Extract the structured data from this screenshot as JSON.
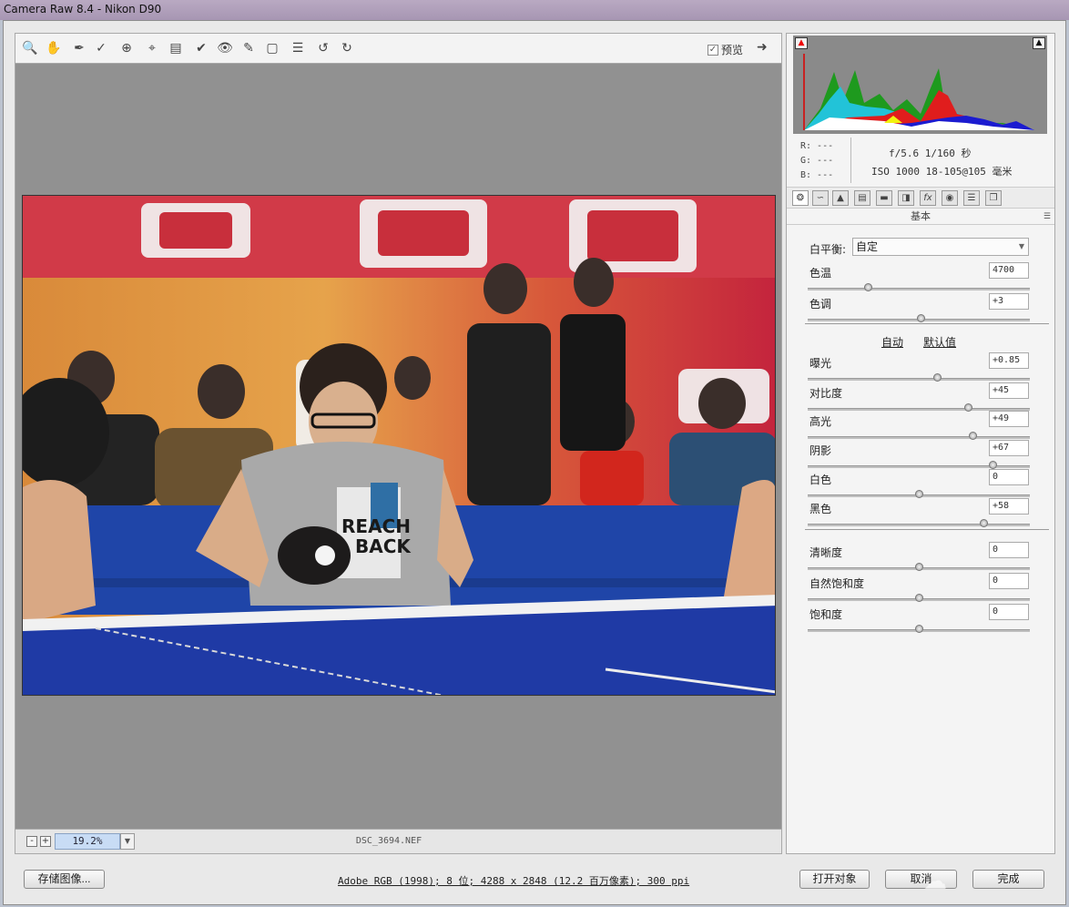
{
  "window": {
    "title": "Camera Raw 8.4 -  Nikon D90"
  },
  "toolbar": {
    "tools": [
      "zoom-icon",
      "hand-icon",
      "white-balance-icon",
      "color-sampler-icon",
      "targeted-adjustment-icon",
      "crop-icon",
      "straighten-icon",
      "spot-removal-icon",
      "red-eye-icon",
      "adjustment-brush-icon",
      "graduated-filter-icon",
      "list-icon",
      "rotate-left-icon",
      "rotate-right-icon"
    ],
    "preview_label": "预览",
    "preview_checked": true
  },
  "canvas": {
    "filename": "DSC_3694.NEF",
    "zoom": "19.2%",
    "zoom_out": "-",
    "zoom_in": "+"
  },
  "histogram": {
    "rgb": {
      "r": "R:  ---",
      "g": "G:  ---",
      "b": "B:  ---"
    },
    "aperture_shutter": "f/5.6  1/160 秒",
    "iso_lens": "ISO 1000  18-105@105 毫米"
  },
  "panel": {
    "title": "基本",
    "white_balance_label": "白平衡:",
    "white_balance_value": "自定",
    "auto_link": "自动",
    "default_link": "默认值",
    "sliders": [
      {
        "label": "色温",
        "value": "4700",
        "pos": 0.27
      },
      {
        "label": "色调",
        "value": "+3",
        "pos": 0.51
      },
      {
        "label": "曝光",
        "value": "+0.85",
        "pos": 0.58
      },
      {
        "label": "对比度",
        "value": "+45",
        "pos": 0.72
      },
      {
        "label": "高光",
        "value": "+49",
        "pos": 0.74
      },
      {
        "label": "阴影",
        "value": "+67",
        "pos": 0.83
      },
      {
        "label": "白色",
        "value": "0",
        "pos": 0.5
      },
      {
        "label": "黑色",
        "value": "+58",
        "pos": 0.79
      },
      {
        "label": "清晰度",
        "value": "0",
        "pos": 0.5
      },
      {
        "label": "自然饱和度",
        "value": "0",
        "pos": 0.5
      },
      {
        "label": "饱和度",
        "value": "0",
        "pos": 0.5
      }
    ]
  },
  "bottom": {
    "save_label": "存储图像...",
    "info": "Adobe RGB (1998); 8 位; 4288 x 2848 (12.2 百万像素); 300 ppi",
    "open_label": "打开对象",
    "cancel_label": "取消",
    "done_label": "完成"
  }
}
